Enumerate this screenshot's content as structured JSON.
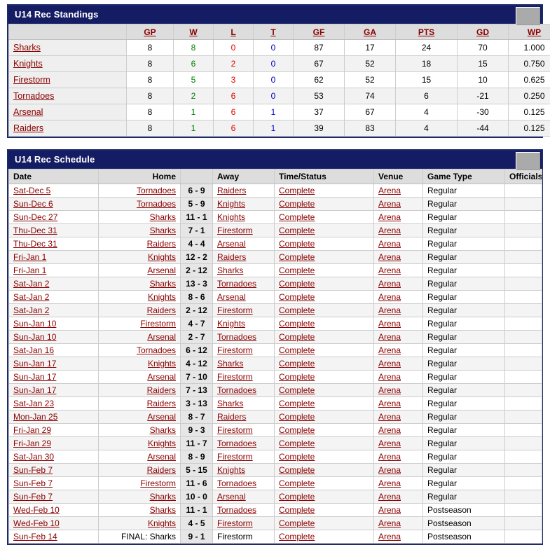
{
  "standings": {
    "title": "U14 Rec Standings",
    "widget": "collapse-widget",
    "columns": [
      "",
      "GP",
      "W",
      "L",
      "T",
      "GF",
      "GA",
      "PTS",
      "GD",
      "WP"
    ],
    "rows": [
      {
        "team": "Sharks",
        "gp": "8",
        "w": "8",
        "l": "0",
        "t": "0",
        "gf": "87",
        "ga": "17",
        "pts": "24",
        "gd": "70",
        "wp": "1.000"
      },
      {
        "team": "Knights",
        "gp": "8",
        "w": "6",
        "l": "2",
        "t": "0",
        "gf": "67",
        "ga": "52",
        "pts": "18",
        "gd": "15",
        "wp": "0.750"
      },
      {
        "team": "Firestorm",
        "gp": "8",
        "w": "5",
        "l": "3",
        "t": "0",
        "gf": "62",
        "ga": "52",
        "pts": "15",
        "gd": "10",
        "wp": "0.625"
      },
      {
        "team": "Tornadoes",
        "gp": "8",
        "w": "2",
        "l": "6",
        "t": "0",
        "gf": "53",
        "ga": "74",
        "pts": "6",
        "gd": "-21",
        "wp": "0.250"
      },
      {
        "team": "Arsenal",
        "gp": "8",
        "w": "1",
        "l": "6",
        "t": "1",
        "gf": "37",
        "ga": "67",
        "pts": "4",
        "gd": "-30",
        "wp": "0.125"
      },
      {
        "team": "Raiders",
        "gp": "8",
        "w": "1",
        "l": "6",
        "t": "1",
        "gf": "39",
        "ga": "83",
        "pts": "4",
        "gd": "-44",
        "wp": "0.125"
      }
    ]
  },
  "schedule": {
    "title": "U14 Rec Schedule",
    "widget": "collapse-widget",
    "columns": [
      "Date",
      "Home",
      "",
      "Away",
      "Time/Status",
      "Venue",
      "Game Type",
      "Officials"
    ],
    "rows": [
      {
        "date": "Sat-Dec 5",
        "home": "Tornadoes",
        "score": "6 - 9",
        "away": "Raiders",
        "status": "Complete",
        "venue": "Arena",
        "type": "Regular",
        "officials": "",
        "final": false
      },
      {
        "date": "Sun-Dec 6",
        "home": "Tornadoes",
        "score": "5 - 9",
        "away": "Knights",
        "status": "Complete",
        "venue": "Arena",
        "type": "Regular",
        "officials": "",
        "final": false
      },
      {
        "date": "Sun-Dec 27",
        "home": "Sharks",
        "score": "11 - 1",
        "away": "Knights",
        "status": "Complete",
        "venue": "Arena",
        "type": "Regular",
        "officials": "",
        "final": false
      },
      {
        "date": "Thu-Dec 31",
        "home": "Sharks",
        "score": "7 - 1",
        "away": "Firestorm",
        "status": "Complete",
        "venue": "Arena",
        "type": "Regular",
        "officials": "",
        "final": false
      },
      {
        "date": "Thu-Dec 31",
        "home": "Raiders",
        "score": "4 - 4",
        "away": "Arsenal",
        "status": "Complete",
        "venue": "Arena",
        "type": "Regular",
        "officials": "",
        "final": false
      },
      {
        "date": "Fri-Jan 1",
        "home": "Knights",
        "score": "12 - 2",
        "away": "Raiders",
        "status": "Complete",
        "venue": "Arena",
        "type": "Regular",
        "officials": "",
        "final": false
      },
      {
        "date": "Fri-Jan 1",
        "home": "Arsenal",
        "score": "2 - 12",
        "away": "Sharks",
        "status": "Complete",
        "venue": "Arena",
        "type": "Regular",
        "officials": "",
        "final": false
      },
      {
        "date": "Sat-Jan 2",
        "home": "Sharks",
        "score": "13 - 3",
        "away": "Tornadoes",
        "status": "Complete",
        "venue": "Arena",
        "type": "Regular",
        "officials": "",
        "final": false
      },
      {
        "date": "Sat-Jan 2",
        "home": "Knights",
        "score": "8 - 6",
        "away": "Arsenal",
        "status": "Complete",
        "venue": "Arena",
        "type": "Regular",
        "officials": "",
        "final": false
      },
      {
        "date": "Sat-Jan 2",
        "home": "Raiders",
        "score": "2 - 12",
        "away": "Firestorm",
        "status": "Complete",
        "venue": "Arena",
        "type": "Regular",
        "officials": "",
        "final": false
      },
      {
        "date": "Sun-Jan 10",
        "home": "Firestorm",
        "score": "4 - 7",
        "away": "Knights",
        "status": "Complete",
        "venue": "Arena",
        "type": "Regular",
        "officials": "",
        "final": false
      },
      {
        "date": "Sun-Jan 10",
        "home": "Arsenal",
        "score": "2 - 7",
        "away": "Tornadoes",
        "status": "Complete",
        "venue": "Arena",
        "type": "Regular",
        "officials": "",
        "final": false
      },
      {
        "date": "Sat-Jan 16",
        "home": "Tornadoes",
        "score": "6 - 12",
        "away": "Firestorm",
        "status": "Complete",
        "venue": "Arena",
        "type": "Regular",
        "officials": "",
        "final": false
      },
      {
        "date": "Sun-Jan 17",
        "home": "Knights",
        "score": "4 - 12",
        "away": "Sharks",
        "status": "Complete",
        "venue": "Arena",
        "type": "Regular",
        "officials": "",
        "final": false
      },
      {
        "date": "Sun-Jan 17",
        "home": "Arsenal",
        "score": "7 - 10",
        "away": "Firestorm",
        "status": "Complete",
        "venue": "Arena",
        "type": "Regular",
        "officials": "",
        "final": false
      },
      {
        "date": "Sun-Jan 17",
        "home": "Raiders",
        "score": "7 - 13",
        "away": "Tornadoes",
        "status": "Complete",
        "venue": "Arena",
        "type": "Regular",
        "officials": "",
        "final": false
      },
      {
        "date": "Sat-Jan 23",
        "home": "Raiders",
        "score": "3 - 13",
        "away": "Sharks",
        "status": "Complete",
        "venue": "Arena",
        "type": "Regular",
        "officials": "",
        "final": false
      },
      {
        "date": "Mon-Jan 25",
        "home": "Arsenal",
        "score": "8 - 7",
        "away": "Raiders",
        "status": "Complete",
        "venue": "Arena",
        "type": "Regular",
        "officials": "",
        "final": false
      },
      {
        "date": "Fri-Jan 29",
        "home": "Sharks",
        "score": "9 - 3",
        "away": "Firestorm",
        "status": "Complete",
        "venue": "Arena",
        "type": "Regular",
        "officials": "",
        "final": false
      },
      {
        "date": "Fri-Jan 29",
        "home": "Knights",
        "score": "11 - 7",
        "away": "Tornadoes",
        "status": "Complete",
        "venue": "Arena",
        "type": "Regular",
        "officials": "",
        "final": false
      },
      {
        "date": "Sat-Jan 30",
        "home": "Arsenal",
        "score": "8 - 9",
        "away": "Firestorm",
        "status": "Complete",
        "venue": "Arena",
        "type": "Regular",
        "officials": "",
        "final": false
      },
      {
        "date": "Sun-Feb 7",
        "home": "Raiders",
        "score": "5 - 15",
        "away": "Knights",
        "status": "Complete",
        "venue": "Arena",
        "type": "Regular",
        "officials": "",
        "final": false
      },
      {
        "date": "Sun-Feb 7",
        "home": "Firestorm",
        "score": "11 - 6",
        "away": "Tornadoes",
        "status": "Complete",
        "venue": "Arena",
        "type": "Regular",
        "officials": "",
        "final": false
      },
      {
        "date": "Sun-Feb 7",
        "home": "Sharks",
        "score": "10 - 0",
        "away": "Arsenal",
        "status": "Complete",
        "venue": "Arena",
        "type": "Regular",
        "officials": "",
        "final": false
      },
      {
        "date": "Wed-Feb 10",
        "home": "Sharks",
        "score": "11 - 1",
        "away": "Tornadoes",
        "status": "Complete",
        "venue": "Arena",
        "type": "Postseason",
        "officials": "",
        "final": false
      },
      {
        "date": "Wed-Feb 10",
        "home": "Knights",
        "score": "4 - 5",
        "away": "Firestorm",
        "status": "Complete",
        "venue": "Arena",
        "type": "Postseason",
        "officials": "",
        "final": false
      },
      {
        "date": "Sun-Feb 14",
        "home": "FINAL: Sharks",
        "score": "9 - 1",
        "away": "Firestorm",
        "status": "Complete",
        "venue": "Arena",
        "type": "Postseason",
        "officials": "",
        "final": true
      }
    ]
  }
}
